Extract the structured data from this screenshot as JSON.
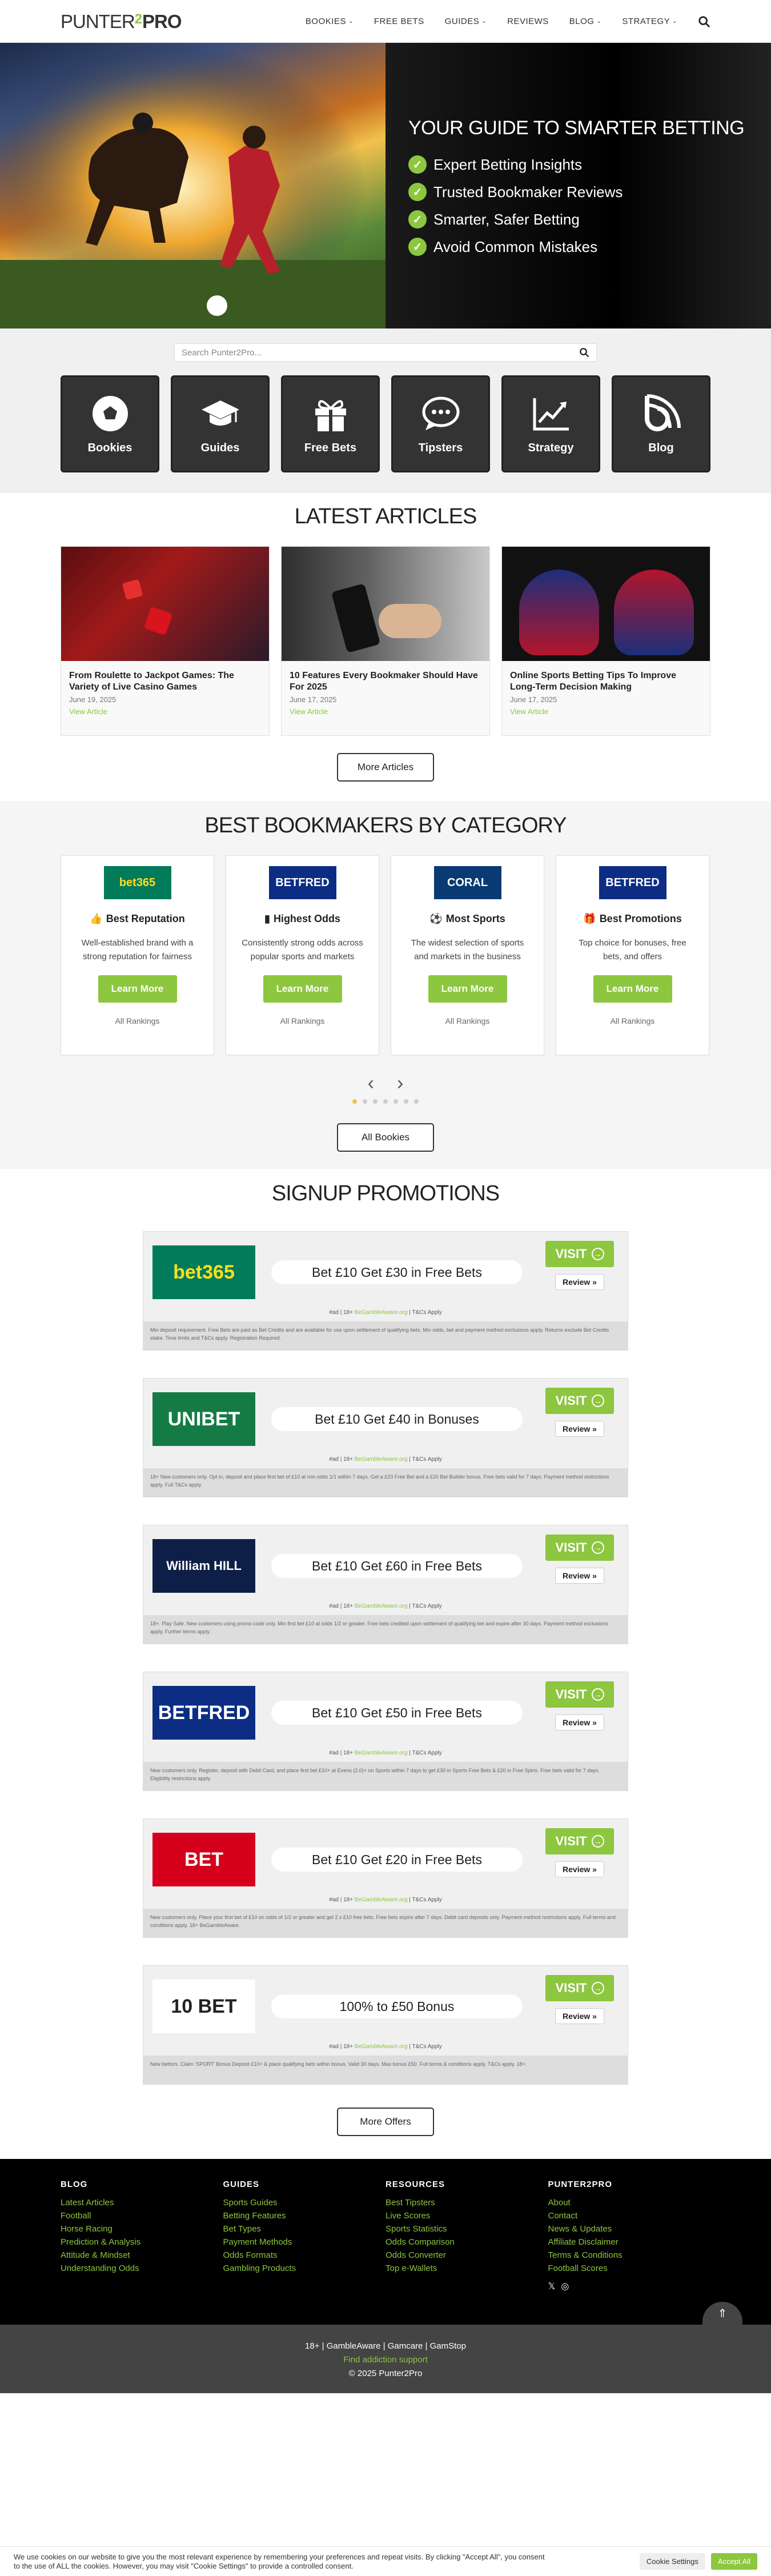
{
  "header": {
    "logo_a": "PUNTER",
    "logo_b": "2",
    "logo_c": "PRO",
    "nav": [
      {
        "label": "BOOKIES",
        "chevron": true
      },
      {
        "label": "FREE BETS",
        "chevron": false
      },
      {
        "label": "GUIDES",
        "chevron": true
      },
      {
        "label": "REVIEWS",
        "chevron": false
      },
      {
        "label": "BLOG",
        "chevron": true
      },
      {
        "label": "STRATEGY",
        "chevron": true
      }
    ],
    "search_icon": "search-icon"
  },
  "hero": {
    "title": "YOUR GUIDE TO SMARTER BETTING",
    "bullets": [
      "Expert Betting Insights",
      "Trusted Bookmaker Reviews",
      "Smarter, Safer Betting",
      "Avoid Common Mistakes"
    ]
  },
  "search": {
    "placeholder": "Search Punter2Pro..."
  },
  "categories": [
    {
      "label": "Bookies",
      "icon": "soccer-ball-icon"
    },
    {
      "label": "Guides",
      "icon": "graduation-cap-icon"
    },
    {
      "label": "Free Bets",
      "icon": "gift-icon"
    },
    {
      "label": "Tipsters",
      "icon": "chat-bubble-icon"
    },
    {
      "label": "Strategy",
      "icon": "chart-line-icon"
    },
    {
      "label": "Blog",
      "icon": "blog-icon"
    }
  ],
  "articles": {
    "title": "LATEST ARTICLES",
    "items": [
      {
        "title": "From Roulette to Jackpot Games: The Variety of Live Casino Games",
        "date": "June 19, 2025",
        "link": "View Article"
      },
      {
        "title": "10 Features Every Bookmaker Should Have For 2025",
        "date": "June 17, 2025",
        "link": "View Article"
      },
      {
        "title": "Online Sports Betting Tips To Improve Long-Term Decision Making",
        "date": "June 17, 2025",
        "link": "View Article"
      }
    ],
    "more": "More Articles"
  },
  "bookies": {
    "title": "BEST BOOKMAKERS BY CATEGORY",
    "cards": [
      {
        "logo": "bet365",
        "logo_bg": "#027b5b",
        "logo_fg": "#ffdf1b",
        "heading": "Best Reputation",
        "icon": "thumbs-up-icon",
        "text": "Well-established brand with a strong reputation for fairness",
        "button": "Learn More",
        "rankings": "All Rankings"
      },
      {
        "logo": "BETFRED",
        "logo_bg": "#0c2d83",
        "logo_fg": "#ffffff",
        "heading": "Highest Odds",
        "icon": "bar-chart-icon",
        "text": "Consistently strong odds across popular sports and markets",
        "button": "Learn More",
        "rankings": "All Rankings"
      },
      {
        "logo": "CORAL",
        "logo_bg": "#0a3a74",
        "logo_fg": "#ffffff",
        "heading": "Most Sports",
        "icon": "soccer-ball-icon",
        "text": "The widest selection of sports and markets in the business",
        "button": "Learn More",
        "rankings": "All Rankings"
      },
      {
        "logo": "BETFRED",
        "logo_bg": "#0c2d83",
        "logo_fg": "#ffffff",
        "heading": "Best Promotions",
        "icon": "gift-icon",
        "text": "Top choice for bonuses, free bets, and offers",
        "button": "Learn More",
        "rankings": "All Rankings"
      }
    ],
    "prev": "‹",
    "next": "›",
    "all": "All Bookies"
  },
  "promos": {
    "title": "SIGNUP PROMOTIONS",
    "items": [
      {
        "brand": "bet365",
        "bg": "#027b5b",
        "fg": "#ffdf1b",
        "offer": "Bet £10 Get £30 in Free Bets",
        "visit": "VISIT",
        "review": "Review »",
        "small_a": "#ad | 18+ ",
        "small_link": "BeGambleAware.org",
        "small_b": " | T&Cs Apply",
        "terms": "Min deposit requirement. Free Bets are paid as Bet Credits and are available for use upon settlement of qualifying bets. Min odds, bet and payment method exclusions apply. Returns exclude Bet Credits stake. Time limits and T&Cs apply. Registration Required."
      },
      {
        "brand": "UNIBET",
        "bg": "#147b45",
        "fg": "#ffffff",
        "offer": "Bet £10 Get £40 in Bonuses",
        "visit": "VISIT",
        "review": "Review »",
        "small_a": "#ad | 18+ ",
        "small_link": "BeGambleAware.org",
        "small_b": " | T&Cs Apply",
        "terms": "18+ New customers only. Opt in, deposit and place first bet of £10 at min odds 1/1 within 7 days. Get a £20 Free Bet and a £20 Bet Builder bonus. Free bets valid for 7 days. Payment method restrictions apply. Full T&Cs apply."
      },
      {
        "brand": "William HILL",
        "bg": "#0e1f47",
        "fg": "#ffffff",
        "offer": "Bet £10 Get £60 in Free Bets",
        "visit": "VISIT",
        "review": "Review »",
        "small_a": "#ad | 18+ ",
        "small_link": "BeGambleAware.org",
        "small_b": " | T&Cs Apply",
        "terms": "18+. Play Safe. New customers using promo code only. Min first bet £10 at odds 1/2 or greater. Free bets credited upon settlement of qualifying bet and expire after 30 days. Payment method exclusions apply. Further terms apply."
      },
      {
        "brand": "BETFRED",
        "bg": "#0c2d83",
        "fg": "#ffffff",
        "offer": "Bet £10 Get £50 in Free Bets",
        "visit": "VISIT",
        "review": "Review »",
        "small_a": "#ad | 18+ ",
        "small_link": "BeGambleAware.org",
        "small_b": " | T&Cs Apply",
        "terms": "New customers only. Register, deposit with Debit Card, and place first bet £10+ at Evens (2.0)+ on Sports within 7 days to get £30 in Sports Free Bets & £20 in Free Spins. Free bets valid for 7 days. Eligibility restrictions apply."
      },
      {
        "brand": "BET",
        "bg": "#d6001c",
        "fg": "#ffffff",
        "offer": "Bet £10 Get £20 in Free Bets",
        "visit": "VISIT",
        "review": "Review »",
        "small_a": "#ad | 18+ ",
        "small_link": "BeGambleAware.org",
        "small_b": " | T&Cs Apply",
        "terms": "New customers only. Place your first bet of £10 on odds of 1/2 or greater and get 2 x £10 free bets. Free bets expire after 7 days. Debit card deposits only. Payment method restrictions apply. Full terms and conditions apply. 18+ BeGambleAware."
      },
      {
        "brand": "10 BET",
        "bg": "#ffffff",
        "fg": "#222222",
        "offer": "100% to £50 Bonus",
        "visit": "VISIT",
        "review": "Review »",
        "small_a": "#ad | 18+ ",
        "small_link": "BeGambleAware.org",
        "small_b": " | T&Cs Apply",
        "terms": "New bettors. Claim 'SPORT' Bonus Deposit £10+ & place qualifying bets within bonus. Valid 30 days. Max bonus £50. Full terms & conditions apply. T&Cs apply. 18+."
      }
    ],
    "more": "More Offers"
  },
  "footer": {
    "cols": [
      {
        "title": "BLOG",
        "links": [
          "Latest Articles",
          "Football",
          "Horse Racing",
          "Prediction & Analysis",
          "Attitude & Mindset",
          "Understanding Odds"
        ]
      },
      {
        "title": "GUIDES",
        "links": [
          "Sports Guides",
          "Betting Features",
          "Bet Types",
          "Payment Methods",
          "Odds Formats",
          "Gambling Products"
        ]
      },
      {
        "title": "RESOURCES",
        "links": [
          "Best Tipsters",
          "Live Scores",
          "Sports Statistics",
          "Odds Comparison",
          "Odds Converter",
          "Top e-Wallets"
        ]
      },
      {
        "title": "PUNTER2PRO",
        "links": [
          "About",
          "Contact",
          "News & Updates",
          "Affiliate Disclaimer",
          "Terms & Conditions",
          "Football Scores"
        ]
      }
    ],
    "social": [
      "twitter-icon",
      "instagram-icon"
    ],
    "totop": "⇑",
    "sub1": "18+ | GambleAware | Gamcare | GamStop",
    "sub2": "Find addiction support",
    "sub3": "© 2025 Punter2Pro"
  },
  "cookie": {
    "text": "We use cookies on our website to give you the most relevant experience by remembering your preferences and repeat visits. By clicking \"Accept All\", you consent to the use of ALL the cookies. However, you may visit \"Cookie Settings\" to provide a controlled consent.",
    "settings": "Cookie Settings",
    "accept": "Accept All"
  }
}
